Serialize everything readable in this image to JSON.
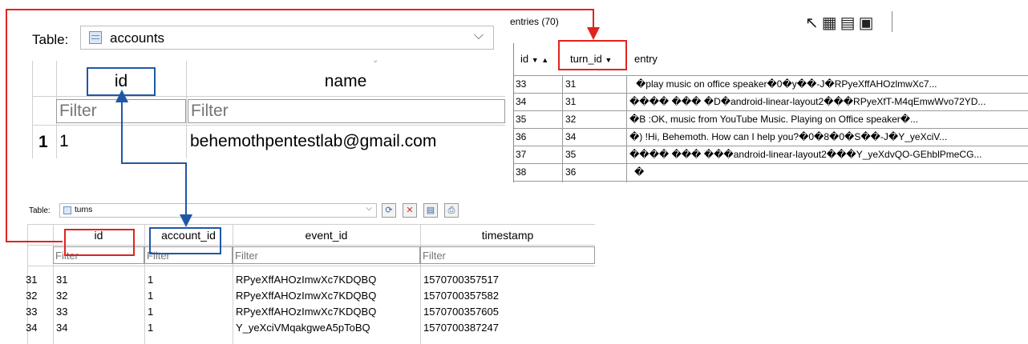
{
  "accounts_view": {
    "table_label": "Table:",
    "table_name": "accounts",
    "columns": [
      "id",
      "name"
    ],
    "filter_placeholder": "Filter",
    "rows": [
      {
        "row_num": "1",
        "id": "1",
        "name": "behemothpentestlab@gmail.com"
      }
    ]
  },
  "entries_view": {
    "title": "entries (70)",
    "columns": [
      "id",
      "turn_id",
      "entry"
    ],
    "rows": [
      {
        "id": "33",
        "turn_id": "31",
        "entry": "�play music on office speaker�0�y��-J�RPyeXffAHOzlmwXc7..."
      },
      {
        "id": "34",
        "turn_id": "31",
        "entry": "���� ��� �D�android-linear-layout2���RPyeXfT-M4qEmwWvo72YD..."
      },
      {
        "id": "35",
        "turn_id": "32",
        "entry": "�B :OK, music from YouTube Music. Playing on Office speaker�..."
      },
      {
        "id": "36",
        "turn_id": "34",
        "entry": "�) !Hi, Behemoth. How can I help you?�0�8�0�S��-J�Y_yeXciV..."
      },
      {
        "id": "37",
        "turn_id": "35",
        "entry": "���� ��� ���android-linear-layout2���Y_yeXdvQO-GEhblPmeCG..."
      },
      {
        "id": "38",
        "turn_id": "36",
        "entry": "�"
      }
    ]
  },
  "turns_view": {
    "table_label": "Table:",
    "table_name": "turns",
    "columns": [
      "id",
      "account_id",
      "event_id",
      "timestamp"
    ],
    "filter_placeholder": "Filter",
    "rows": [
      {
        "row_num": "31",
        "id": "31",
        "account_id": "1",
        "event_id": "RPyeXffAHOzImwXc7KDQBQ",
        "timestamp": "1570700357517"
      },
      {
        "row_num": "32",
        "id": "32",
        "account_id": "1",
        "event_id": "RPyeXffAHOzImwXc7KDQBQ",
        "timestamp": "1570700357582"
      },
      {
        "row_num": "33",
        "id": "33",
        "account_id": "1",
        "event_id": "RPyeXffAHOzImwXc7KDQBQ",
        "timestamp": "1570700357605"
      },
      {
        "row_num": "34",
        "id": "34",
        "account_id": "1",
        "event_id": "Y_yeXciVMqakgweA5pToBQ",
        "timestamp": "1570700387247"
      }
    ]
  },
  "colors": {
    "annotation_red": "#e0231e",
    "annotation_blue": "#1f57a8"
  },
  "icons": [
    "table-icon",
    "dropdown-arrow-icon",
    "sort-desc-icon",
    "sort-asc-icon",
    "refresh-icon",
    "clear-filter-icon",
    "save-icon",
    "print-icon"
  ]
}
